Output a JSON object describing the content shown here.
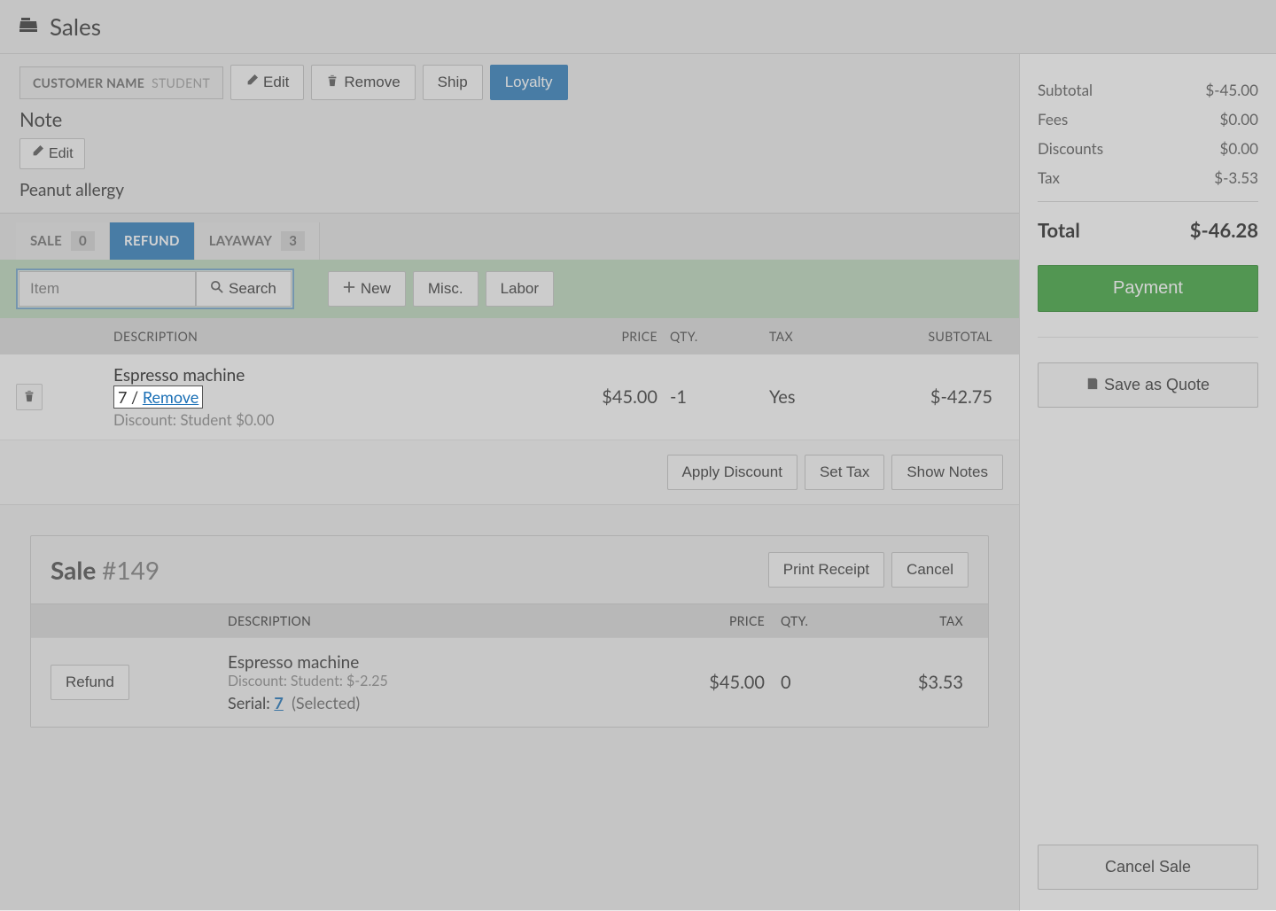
{
  "header": {
    "title": "Sales"
  },
  "toolbar": {
    "customer_label": "CUSTOMER NAME",
    "customer_value": "STUDENT",
    "edit_label": "Edit",
    "remove_label": "Remove",
    "ship_label": "Ship",
    "loyalty_label": "Loyalty"
  },
  "note": {
    "heading": "Note",
    "edit_label": "Edit",
    "text": "Peanut allergy"
  },
  "tabs": {
    "sale_label": "SALE",
    "sale_count": "0",
    "refund_label": "REFUND",
    "layaway_label": "LAYAWAY",
    "layaway_count": "3"
  },
  "search": {
    "item_placeholder": "Item",
    "search_label": "Search",
    "new_label": "New",
    "misc_label": "Misc.",
    "labor_label": "Labor"
  },
  "columns": {
    "description": "DESCRIPTION",
    "price": "PRICE",
    "qty": "QTY.",
    "tax": "TAX",
    "subtotal": "SUBTOTAL"
  },
  "line": {
    "name": "Espresso machine",
    "serial_num": "7",
    "serial_sep": " / ",
    "serial_remove": "Remove",
    "discount": "Discount: Student $0.00",
    "price": "$45.00",
    "qty": "-1",
    "tax": "Yes",
    "subtotal": "$-42.75"
  },
  "actions": {
    "apply_discount": "Apply Discount",
    "set_tax": "Set Tax",
    "show_notes": "Show Notes"
  },
  "sale_card": {
    "title_prefix": "Sale ",
    "title_num": "#149",
    "print_receipt": "Print Receipt",
    "cancel": "Cancel",
    "refund": "Refund",
    "line": {
      "name": "Espresso machine",
      "discount": "Discount: Student: $-2.25",
      "serial_label": "Serial: ",
      "serial_num": "7",
      "serial_selected": "(Selected)",
      "price": "$45.00",
      "qty": "0",
      "tax": "$3.53"
    }
  },
  "totals": {
    "subtotal_label": "Subtotal",
    "subtotal_value": "$-45.00",
    "fees_label": "Fees",
    "fees_value": "$0.00",
    "discounts_label": "Discounts",
    "discounts_value": "$0.00",
    "tax_label": "Tax",
    "tax_value": "$-3.53",
    "total_label": "Total",
    "total_value": "$-46.28"
  },
  "right_actions": {
    "payment": "Payment",
    "save_quote": "Save as Quote",
    "cancel_sale": "Cancel Sale"
  }
}
